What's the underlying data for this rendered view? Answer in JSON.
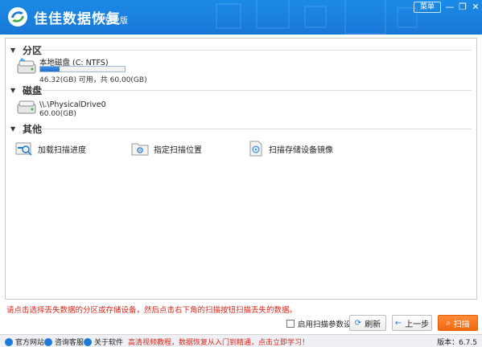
{
  "app": {
    "title": "佳佳数据恢复",
    "edition": "专业版",
    "menu_label": "菜单",
    "minimize": "—",
    "restore": "❐",
    "close": "✕"
  },
  "sections": {
    "partition": "分区",
    "disk": "磁盘",
    "other": "其他"
  },
  "partition_drive": {
    "name": "本地磁盘 (C: NTFS)",
    "usage": "46.32(GB) 可用，共 60.00(GB)",
    "used_fraction": 0.23
  },
  "physical_drive": {
    "name": "\\\\.\\PhysicalDrive0",
    "size": "60.00(GB)"
  },
  "other_items": {
    "load_progress": "加载扫描进度",
    "specify_location": "指定扫描位置",
    "scan_image": "扫描存储设备镜像"
  },
  "footer": {
    "hint": "请点击选择丢失数据的分区或存储设备，然后点击右下角的扫描按钮扫描丢失的数据。",
    "advanced_settings": "启用扫描参数设置",
    "refresh": "刷新",
    "back": "上一步",
    "scan": "扫描"
  },
  "statusbar": {
    "website": "官方网站",
    "support": "咨询客服",
    "about": "关于软件",
    "promo": "高清视频教程，数据恢复从入门到精通，点击立即学习！",
    "version": "版本：6.7.5"
  },
  "colors": {
    "titlebar": "#1877d8",
    "accent": "#1c7ad8",
    "scan_button": "#f06a0d",
    "hint_text": "#d9261c"
  },
  "icons": {
    "logo": "app-logo-icon",
    "hdd": "hard-disk-icon",
    "load": "load-progress-icon",
    "location": "scan-location-icon",
    "image": "disk-image-icon",
    "refresh": "refresh-icon",
    "back": "back-icon",
    "scan": "scan-search-icon"
  }
}
